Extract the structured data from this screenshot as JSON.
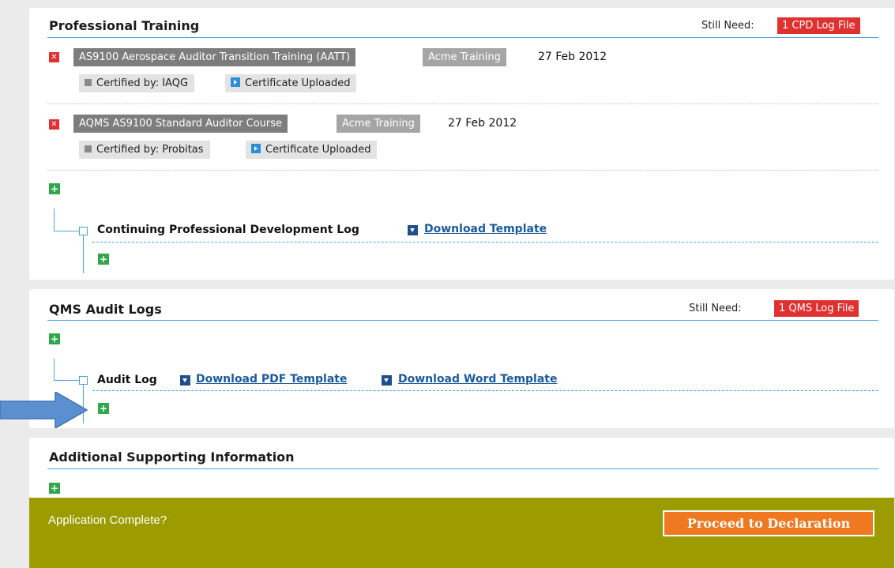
{
  "professional_training": {
    "title": "Professional Training",
    "still_need_label": "Still Need:",
    "still_need_value": "1 CPD Log File",
    "courses": [
      {
        "remove_icon": "x-icon",
        "name": "AS9100 Aerospace Auditor Transition Training (AATT)",
        "provider": "Acme Training",
        "date": "27 Feb 2012",
        "certified_by": "Certified by: IAQG",
        "certificate_status": "Certificate Uploaded"
      },
      {
        "remove_icon": "x-icon",
        "name": "AQMS AS9100 Standard Auditor Course",
        "provider": "Acme Training",
        "date": "27 Feb 2012",
        "certified_by": "Certified by: Probitas",
        "certificate_status": "Certificate Uploaded"
      }
    ],
    "cpd_log": {
      "title": "Continuing Professional Development Log",
      "download_label": "Download Template"
    }
  },
  "qms_audit_logs": {
    "title": "QMS Audit Logs",
    "still_need_label": "Still Need:",
    "still_need_value": "1 QMS Log File",
    "audit_log": {
      "title": "Audit Log",
      "download_pdf_label": "Download PDF Template",
      "download_word_label": "Download Word Template"
    }
  },
  "additional_info": {
    "title": "Additional Supporting Information"
  },
  "footer": {
    "question": "Application Complete?",
    "proceed_label": "Proceed to Declaration"
  },
  "colors": {
    "accent_blue": "#4aa3db",
    "need_red": "#e03131",
    "add_green": "#2fa84a",
    "footer_olive": "#9c9c00",
    "proceed_orange": "#f07820",
    "annotation_arrow": "#5b8fd0"
  },
  "icons": {
    "remove": "x-icon",
    "add": "plus-icon",
    "certified": "grey-square-icon",
    "uploaded": "blue-play-icon",
    "download": "download-icon",
    "tree_node": "tree-node-icon",
    "annotation": "arrow-right-icon"
  }
}
